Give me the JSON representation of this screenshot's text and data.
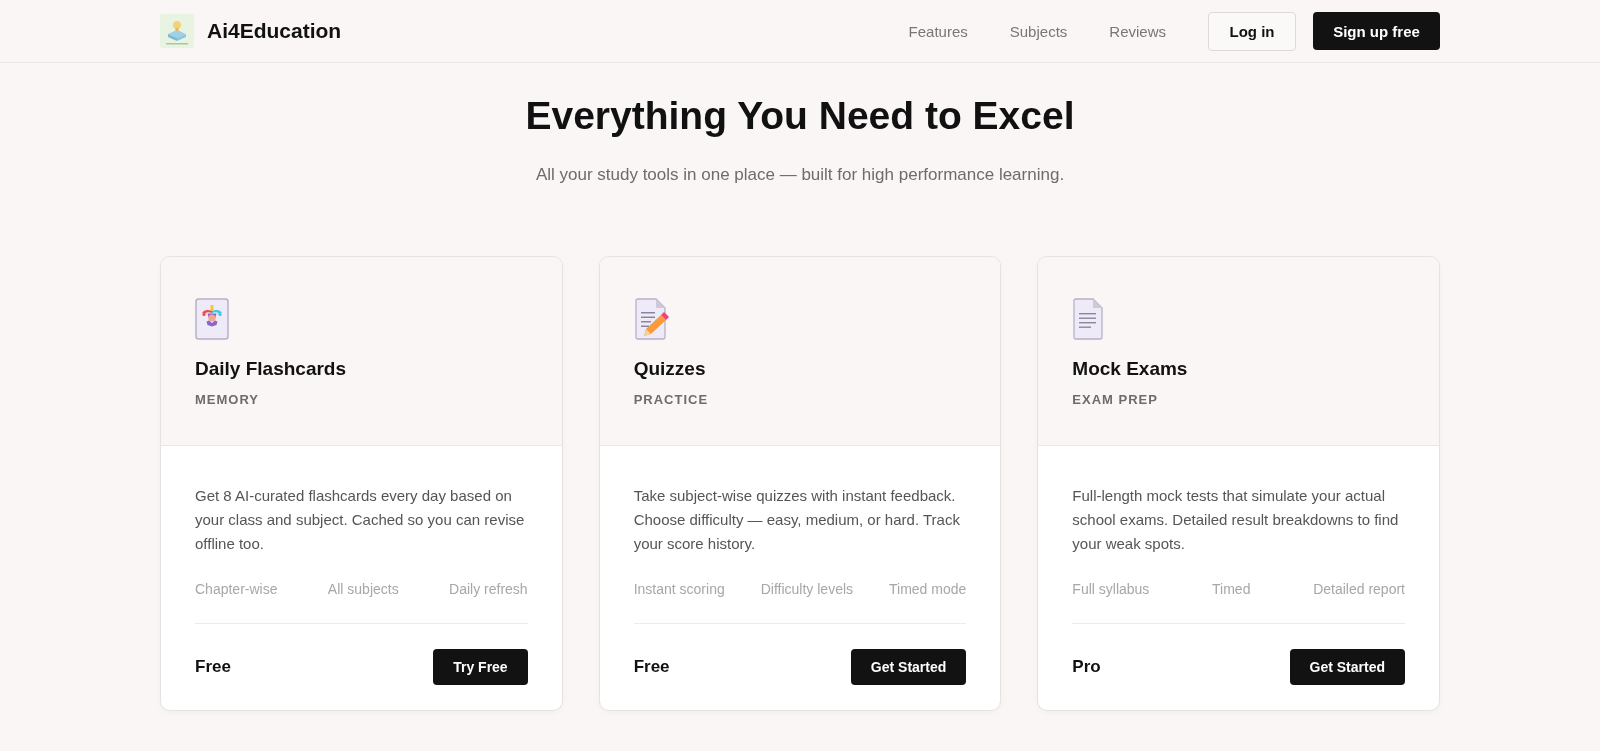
{
  "header": {
    "brand": "Ai4Education",
    "nav": [
      {
        "label": "Features"
      },
      {
        "label": "Subjects"
      },
      {
        "label": "Reviews"
      }
    ],
    "login_button": "Log in",
    "signup_button": "Sign up free"
  },
  "hero": {
    "title": "Everything You Need to Excel",
    "subtitle": "All your study tools in one place — built for high performance learning."
  },
  "cards": [
    {
      "title": "Daily Flashcards",
      "tag": "MEMORY",
      "description": "Get 8 AI-curated flashcards every day based on your class and subject. Cached so you can revise offline too.",
      "features": [
        "Chapter-wise",
        "All subjects",
        "Daily refresh"
      ],
      "price": "Free",
      "button": "Try Free"
    },
    {
      "title": "Quizzes",
      "tag": "PRACTICE",
      "description": "Take subject-wise quizzes with instant feedback. Choose difficulty — easy, medium, or hard. Track your score history.",
      "features": [
        "Instant scoring",
        "Difficulty levels",
        "Timed mode"
      ],
      "price": "Free",
      "button": "Get Started"
    },
    {
      "title": "Mock Exams",
      "tag": "EXAM PREP",
      "description": "Full-length mock tests that simulate your actual school exams. Detailed result breakdowns to find your weak spots.",
      "features": [
        "Full syllabus",
        "Timed",
        "Detailed report"
      ],
      "price": "Pro",
      "button": "Get Started"
    }
  ]
}
